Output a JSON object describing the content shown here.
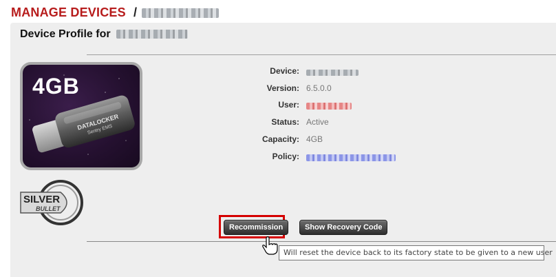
{
  "header": {
    "title": "MANAGE DEVICES",
    "separator": "/"
  },
  "profile": {
    "title": "Device Profile for"
  },
  "device_image": {
    "capacity_text": "4GB",
    "brand_text": "DATALOCKER",
    "model_text": "Sentry EMS"
  },
  "logo": {
    "line1": "SILVER",
    "line2": "BULLET"
  },
  "fields": [
    {
      "label": "Device:",
      "value": ""
    },
    {
      "label": "Version:",
      "value": "6.5.0.0"
    },
    {
      "label": "User:",
      "value": ""
    },
    {
      "label": "Status:",
      "value": "Active"
    },
    {
      "label": "Capacity:",
      "value": "4GB"
    },
    {
      "label": "Policy:",
      "value": ""
    }
  ],
  "buttons": {
    "recommission": "Recommission",
    "show_recovery_code": "Show Recovery Code"
  },
  "tooltip": {
    "text": "Will reset the device back to its factory state to be given to a new user"
  },
  "colors": {
    "header_red": "#b71c1c",
    "highlight_red": "#d50000",
    "user_value_red": "#e57373",
    "policy_value_blue": "#7b86e6"
  }
}
